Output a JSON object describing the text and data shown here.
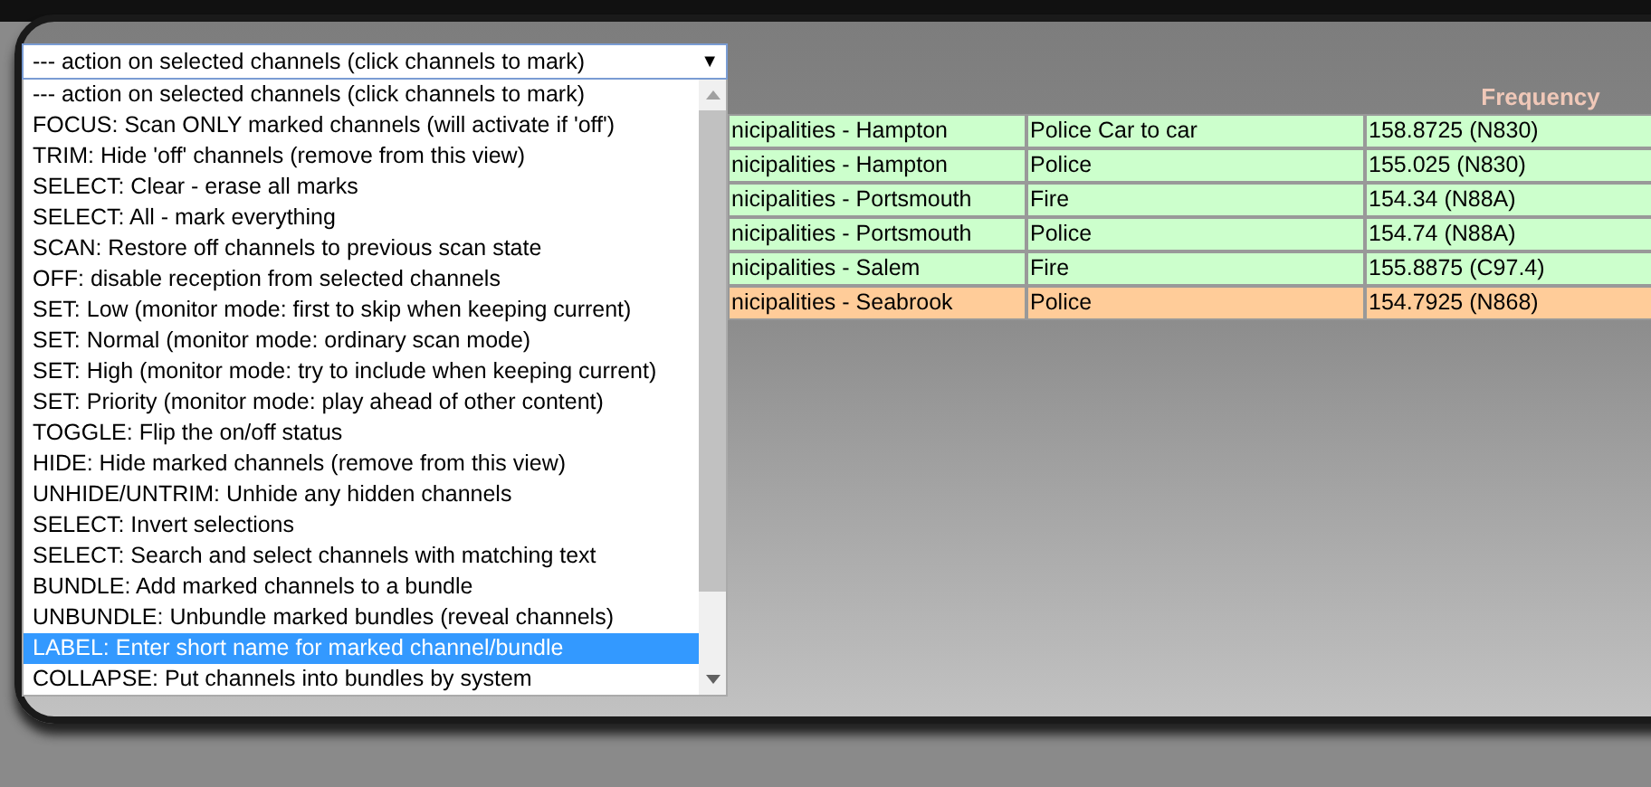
{
  "action_select": {
    "value": "--- action on selected channels (click channels to mark)",
    "arrow": "▼"
  },
  "action_options": [
    {
      "label": "--- action on selected channels (click channels to mark)",
      "selected": false
    },
    {
      "label": "FOCUS: Scan ONLY marked channels (will activate if 'off')",
      "selected": false
    },
    {
      "label": "TRIM: Hide 'off' channels (remove from this view)",
      "selected": false
    },
    {
      "label": "SELECT: Clear - erase all marks",
      "selected": false
    },
    {
      "label": "SELECT: All - mark everything",
      "selected": false
    },
    {
      "label": "SCAN: Restore off channels to previous scan state",
      "selected": false
    },
    {
      "label": "OFF: disable reception from selected channels",
      "selected": false
    },
    {
      "label": "SET: Low (monitor mode: first to skip when keeping current)",
      "selected": false
    },
    {
      "label": "SET: Normal (monitor mode: ordinary scan mode)",
      "selected": false
    },
    {
      "label": "SET: High (monitor mode: try to include when keeping current)",
      "selected": false
    },
    {
      "label": "SET: Priority (monitor mode: play ahead of other content)",
      "selected": false
    },
    {
      "label": "TOGGLE: Flip the on/off status",
      "selected": false
    },
    {
      "label": "HIDE: Hide marked channels (remove from this view)",
      "selected": false
    },
    {
      "label": "UNHIDE/UNTRIM: Unhide any hidden channels",
      "selected": false
    },
    {
      "label": "SELECT: Invert selections",
      "selected": false
    },
    {
      "label": "SELECT: Search and select channels with matching text",
      "selected": false
    },
    {
      "label": "BUNDLE: Add marked channels to a bundle",
      "selected": false
    },
    {
      "label": "UNBUNDLE: Unbundle marked bundles (reveal channels)",
      "selected": false
    },
    {
      "label": "LABEL: Enter short name for marked channel/bundle",
      "selected": true
    },
    {
      "label": "COLLAPSE: Put channels into bundles by system",
      "selected": false
    }
  ],
  "channel_table": {
    "frequency_heading": "Frequency",
    "rows": [
      {
        "column_1": "nicipalities - Hampton",
        "column_2": "Police Car to car",
        "frequency": "158.8725 (N830)",
        "color": "#ccffcc"
      },
      {
        "column_1": "nicipalities - Hampton",
        "column_2": "Police",
        "frequency": "155.025 (N830)",
        "color": "#ccffcc"
      },
      {
        "column_1": "nicipalities - Portsmouth",
        "column_2": "Fire",
        "frequency": "154.34 (N88A)",
        "color": "#ccffcc"
      },
      {
        "column_1": "nicipalities - Portsmouth",
        "column_2": "Police",
        "frequency": "154.74 (N88A)",
        "color": "#ccffcc"
      },
      {
        "column_1": "nicipalities - Salem",
        "column_2": "Fire",
        "frequency": "155.8875 (C97.4)",
        "color": "#ccffcc"
      },
      {
        "column_1": "nicipalities - Seabrook",
        "column_2": "Police",
        "frequency": "154.7925 (N868)",
        "color": "#ffcc99"
      }
    ]
  }
}
